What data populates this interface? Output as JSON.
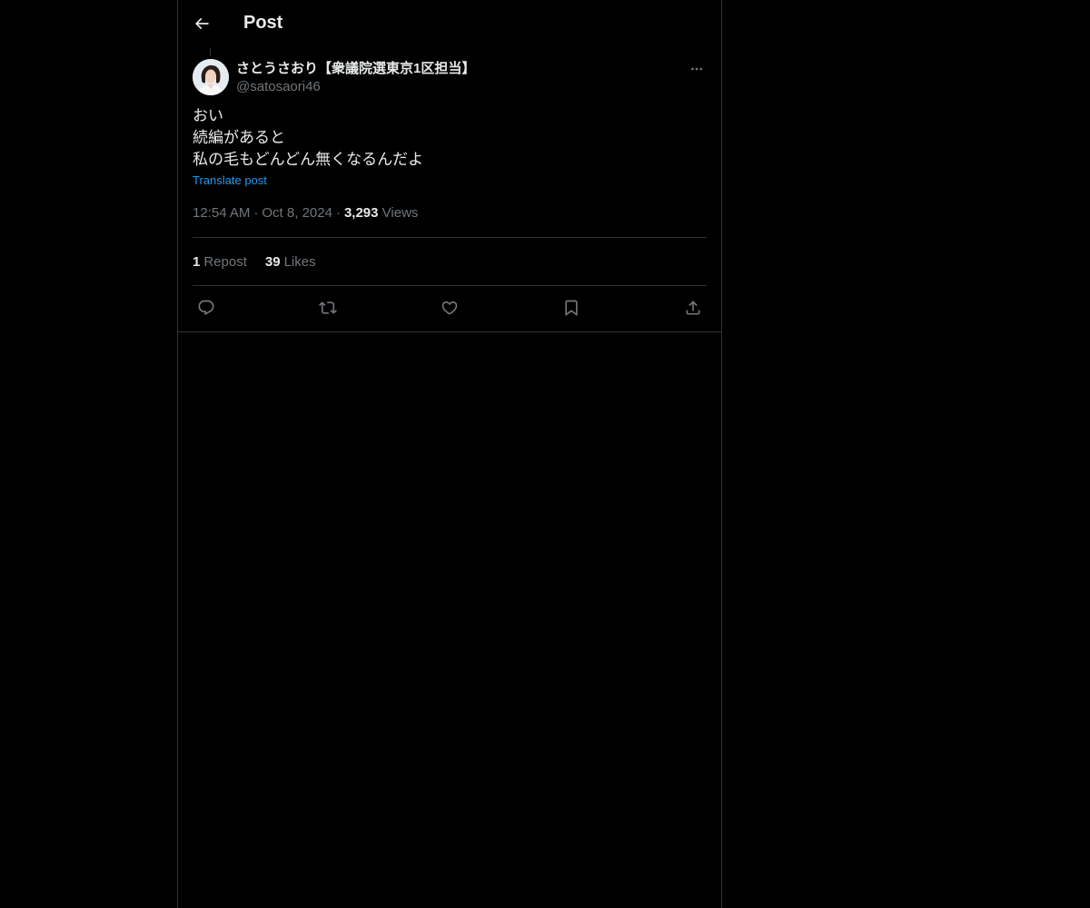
{
  "header": {
    "back_icon": "arrow-left-icon",
    "title": "Post"
  },
  "post": {
    "author": {
      "display_name": "さとうさおり【衆議院選東京1区担当】",
      "handle": "@satosaori46"
    },
    "more_icon": "ellipsis-icon",
    "text_lines": [
      "おい",
      "続編があると",
      "私の毛もどんどん無くなるんだよ"
    ],
    "translate_label": "Translate post",
    "time": "12:54 AM",
    "date": "Oct 8, 2024",
    "views_count": "3,293",
    "views_label": "Views",
    "separator": "·",
    "stats": {
      "reposts_count": "1",
      "reposts_label": "Repost",
      "likes_count": "39",
      "likes_label": "Likes"
    },
    "actions": [
      {
        "name": "reply",
        "icon": "comment-icon"
      },
      {
        "name": "repost",
        "icon": "repost-icon"
      },
      {
        "name": "like",
        "icon": "heart-icon"
      },
      {
        "name": "bookmark",
        "icon": "bookmark-icon"
      },
      {
        "name": "share",
        "icon": "share-icon"
      }
    ]
  },
  "colors": {
    "background": "#000000",
    "text": "#e7e9ea",
    "muted": "#71767b",
    "link": "#1d9bf0",
    "border": "#2f3336"
  }
}
